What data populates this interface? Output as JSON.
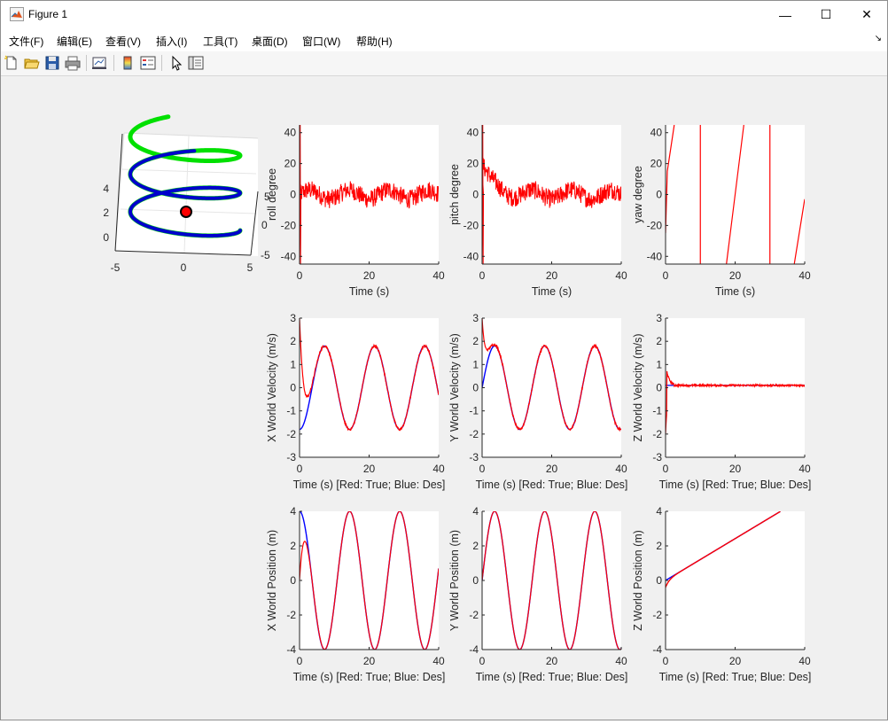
{
  "window": {
    "title": "Figure 1",
    "minimize_glyph": "—",
    "maximize_glyph": "☐",
    "close_glyph": "✕"
  },
  "menu": {
    "items": [
      {
        "label": "文件(F)"
      },
      {
        "label": "编辑(E)"
      },
      {
        "label": "查看(V)"
      },
      {
        "label": "插入(I)"
      },
      {
        "label": "工具(T)"
      },
      {
        "label": "桌面(D)"
      },
      {
        "label": "窗口(W)"
      },
      {
        "label": "帮助(H)"
      }
    ],
    "dock_arrow": "↘"
  },
  "toolbar": {
    "buttons": [
      "new-figure-icon",
      "open-file-icon",
      "save-icon",
      "print-icon",
      "link-plot-icon",
      "colorbar-icon",
      "legend-icon",
      "edit-plot-pointer-icon",
      "property-inspector-icon"
    ]
  },
  "colors": {
    "true_series": "#ff0000",
    "desired_series": "#0000ff",
    "trajectory_true": "#0000cc",
    "trajectory_desired": "#00e000",
    "quad_marker": "#ff0000"
  },
  "chart_data": [
    {
      "id": "trajectory-3d",
      "type": "scatter",
      "title": "",
      "x_ticks": [
        "-5",
        "0",
        "5"
      ],
      "y_ticks": [
        "5",
        "0",
        "-5"
      ],
      "z_ticks": [
        "0",
        "2",
        "4"
      ],
      "series": [],
      "description_only_shape": "helix",
      "helix": {
        "radius": 4,
        "turns": 2.7,
        "z_range": [
          0,
          4
        ]
      },
      "marker_position": [
        0,
        0,
        2.2
      ]
    },
    {
      "id": "roll",
      "type": "line",
      "ylabel": "roll degree",
      "xlabel": "Time (s)",
      "xlim": [
        0,
        40
      ],
      "ylim": [
        -45,
        45
      ],
      "x_ticks": [
        "0",
        "20",
        "40"
      ],
      "y_ticks": [
        "40",
        "20",
        "0",
        "-20",
        "-40"
      ],
      "series": [
        {
          "kind": "noise",
          "mean": 0,
          "amp": 6,
          "spike": {
            "t": 0.2,
            "from": -45,
            "to": 45
          },
          "color": "#ff0000"
        }
      ]
    },
    {
      "id": "pitch",
      "type": "line",
      "ylabel": "pitch degree",
      "xlabel": "Time (s)",
      "xlim": [
        0,
        40
      ],
      "ylim": [
        -45,
        45
      ],
      "x_ticks": [
        "0",
        "20",
        "40"
      ],
      "y_ticks": [
        "40",
        "20",
        "0",
        "-20",
        "-40"
      ],
      "series": [
        {
          "kind": "noise",
          "mean": 0,
          "amp": 6,
          "spike": {
            "t": 0.2,
            "from": -45,
            "to": 45
          },
          "decay": {
            "from": 20,
            "tau": 3
          },
          "color": "#ff0000"
        }
      ]
    },
    {
      "id": "yaw",
      "type": "line",
      "ylabel": "yaw degree",
      "xlabel": "Time (s)",
      "xlim": [
        0,
        40
      ],
      "ylim": [
        -45,
        45
      ],
      "x_ticks": [
        "0",
        "20",
        "40"
      ],
      "y_ticks": [
        "40",
        "20",
        "0",
        "-20",
        "-40"
      ],
      "series": [
        {
          "kind": "segments",
          "color": "#ff0000",
          "segments": [
            [
              [
                0,
                -25
              ],
              [
                0.5,
                15
              ],
              [
                2.5,
                45
              ]
            ],
            [
              [
                10,
                -45
              ],
              [
                10,
                45
              ]
            ],
            [
              [
                17.5,
                -45
              ],
              [
                22.5,
                45
              ]
            ],
            [
              [
                30,
                -45
              ],
              [
                30,
                45
              ]
            ],
            [
              [
                37,
                -45
              ],
              [
                40,
                -3
              ]
            ]
          ]
        }
      ]
    },
    {
      "id": "x-velocity",
      "type": "line",
      "ylabel": "X World Velocity (m/s)",
      "xlabel": "Time (s) [Red: True; Blue: Des]",
      "xlim": [
        0,
        40
      ],
      "ylim": [
        -3,
        3
      ],
      "x_ticks": [
        "0",
        "20",
        "40"
      ],
      "y_ticks": [
        "3",
        "2",
        "1",
        "0",
        "-1",
        "-2",
        "-3"
      ],
      "series": [
        {
          "name": "Des",
          "kind": "sin",
          "amp": 1.8,
          "period": 14.4,
          "phase": -1.5708,
          "offset": 0,
          "color": "#0000ff"
        },
        {
          "name": "True",
          "kind": "sin",
          "amp": 1.8,
          "period": 14.4,
          "phase": -1.5708,
          "offset": 0,
          "noise": 0.05,
          "start": 3,
          "color": "#ff0000"
        }
      ]
    },
    {
      "id": "y-velocity",
      "type": "line",
      "ylabel": "Y World Velocity (m/s)",
      "xlabel": "Time (s) [Red: True; Blue: Des]",
      "xlim": [
        0,
        40
      ],
      "ylim": [
        -3,
        3
      ],
      "x_ticks": [
        "0",
        "20",
        "40"
      ],
      "y_ticks": [
        "3",
        "2",
        "1",
        "0",
        "-1",
        "-2",
        "-3"
      ],
      "series": [
        {
          "name": "Des",
          "kind": "sin",
          "amp": 1.8,
          "period": 14.4,
          "phase": 0,
          "offset": 0,
          "color": "#0000ff"
        },
        {
          "name": "True",
          "kind": "sin",
          "amp": 1.8,
          "period": 14.4,
          "phase": 0,
          "offset": 0,
          "noise": 0.05,
          "start": 3,
          "color": "#ff0000"
        }
      ]
    },
    {
      "id": "z-velocity",
      "type": "line",
      "ylabel": "Z World Velocity (m/s)",
      "xlabel": "Time (s) [Red: True; Blue: Des]",
      "xlim": [
        0,
        40
      ],
      "ylim": [
        -3,
        3
      ],
      "x_ticks": [
        "0",
        "20",
        "40"
      ],
      "y_ticks": [
        "3",
        "2",
        "1",
        "0",
        "-1",
        "-2",
        "-3"
      ],
      "series": [
        {
          "name": "Des",
          "kind": "const",
          "value": 0.1,
          "color": "#0000ff"
        },
        {
          "name": "True",
          "kind": "const",
          "value": 0.1,
          "noise": 0.04,
          "start": -2,
          "color": "#ff0000"
        }
      ]
    },
    {
      "id": "x-position",
      "type": "line",
      "ylabel": "X World Position (m)",
      "xlabel": "Time (s) [Red: True; Blue: Des]",
      "xlim": [
        0,
        40
      ],
      "ylim": [
        -4,
        4
      ],
      "x_ticks": [
        "0",
        "20",
        "40"
      ],
      "y_ticks": [
        "4",
        "2",
        "0",
        "-2",
        "-4"
      ],
      "series": [
        {
          "name": "Des",
          "kind": "sin",
          "amp": 4,
          "period": 14.4,
          "phase": 1.5708,
          "offset": 0,
          "color": "#0000ff"
        },
        {
          "name": "True",
          "kind": "sin",
          "amp": 4,
          "period": 14.4,
          "phase": 1.5708,
          "offset": 0,
          "start": 0,
          "color": "#ff0000"
        }
      ]
    },
    {
      "id": "y-position",
      "type": "line",
      "ylabel": "Y World Position (m)",
      "xlabel": "Time (s) [Red: True; Blue: Des]",
      "xlim": [
        0,
        40
      ],
      "ylim": [
        -4,
        4
      ],
      "x_ticks": [
        "0",
        "20",
        "40"
      ],
      "y_ticks": [
        "4",
        "2",
        "0",
        "-2",
        "-4"
      ],
      "series": [
        {
          "name": "Des",
          "kind": "sin",
          "amp": 4,
          "period": 14.4,
          "phase": 0,
          "offset": 0,
          "color": "#0000ff"
        },
        {
          "name": "True",
          "kind": "sin",
          "amp": 4,
          "period": 14.4,
          "phase": 0,
          "offset": 0,
          "color": "#ff0000"
        }
      ]
    },
    {
      "id": "z-position",
      "type": "line",
      "ylabel": "Z World Position (m)",
      "xlabel": "Time (s) [Red: True; Blue: Des]",
      "xlim": [
        0,
        40
      ],
      "ylim": [
        -4,
        4
      ],
      "x_ticks": [
        "0",
        "20",
        "40"
      ],
      "y_ticks": [
        "4",
        "2",
        "0",
        "-2",
        "-4"
      ],
      "series": [
        {
          "name": "Des",
          "kind": "ramp",
          "slope": 0.121,
          "t_end": 33,
          "color": "#0000ff"
        },
        {
          "name": "True",
          "kind": "ramp",
          "slope": 0.121,
          "t_end": 33,
          "start": -0.4,
          "color": "#ff0000"
        }
      ]
    }
  ]
}
